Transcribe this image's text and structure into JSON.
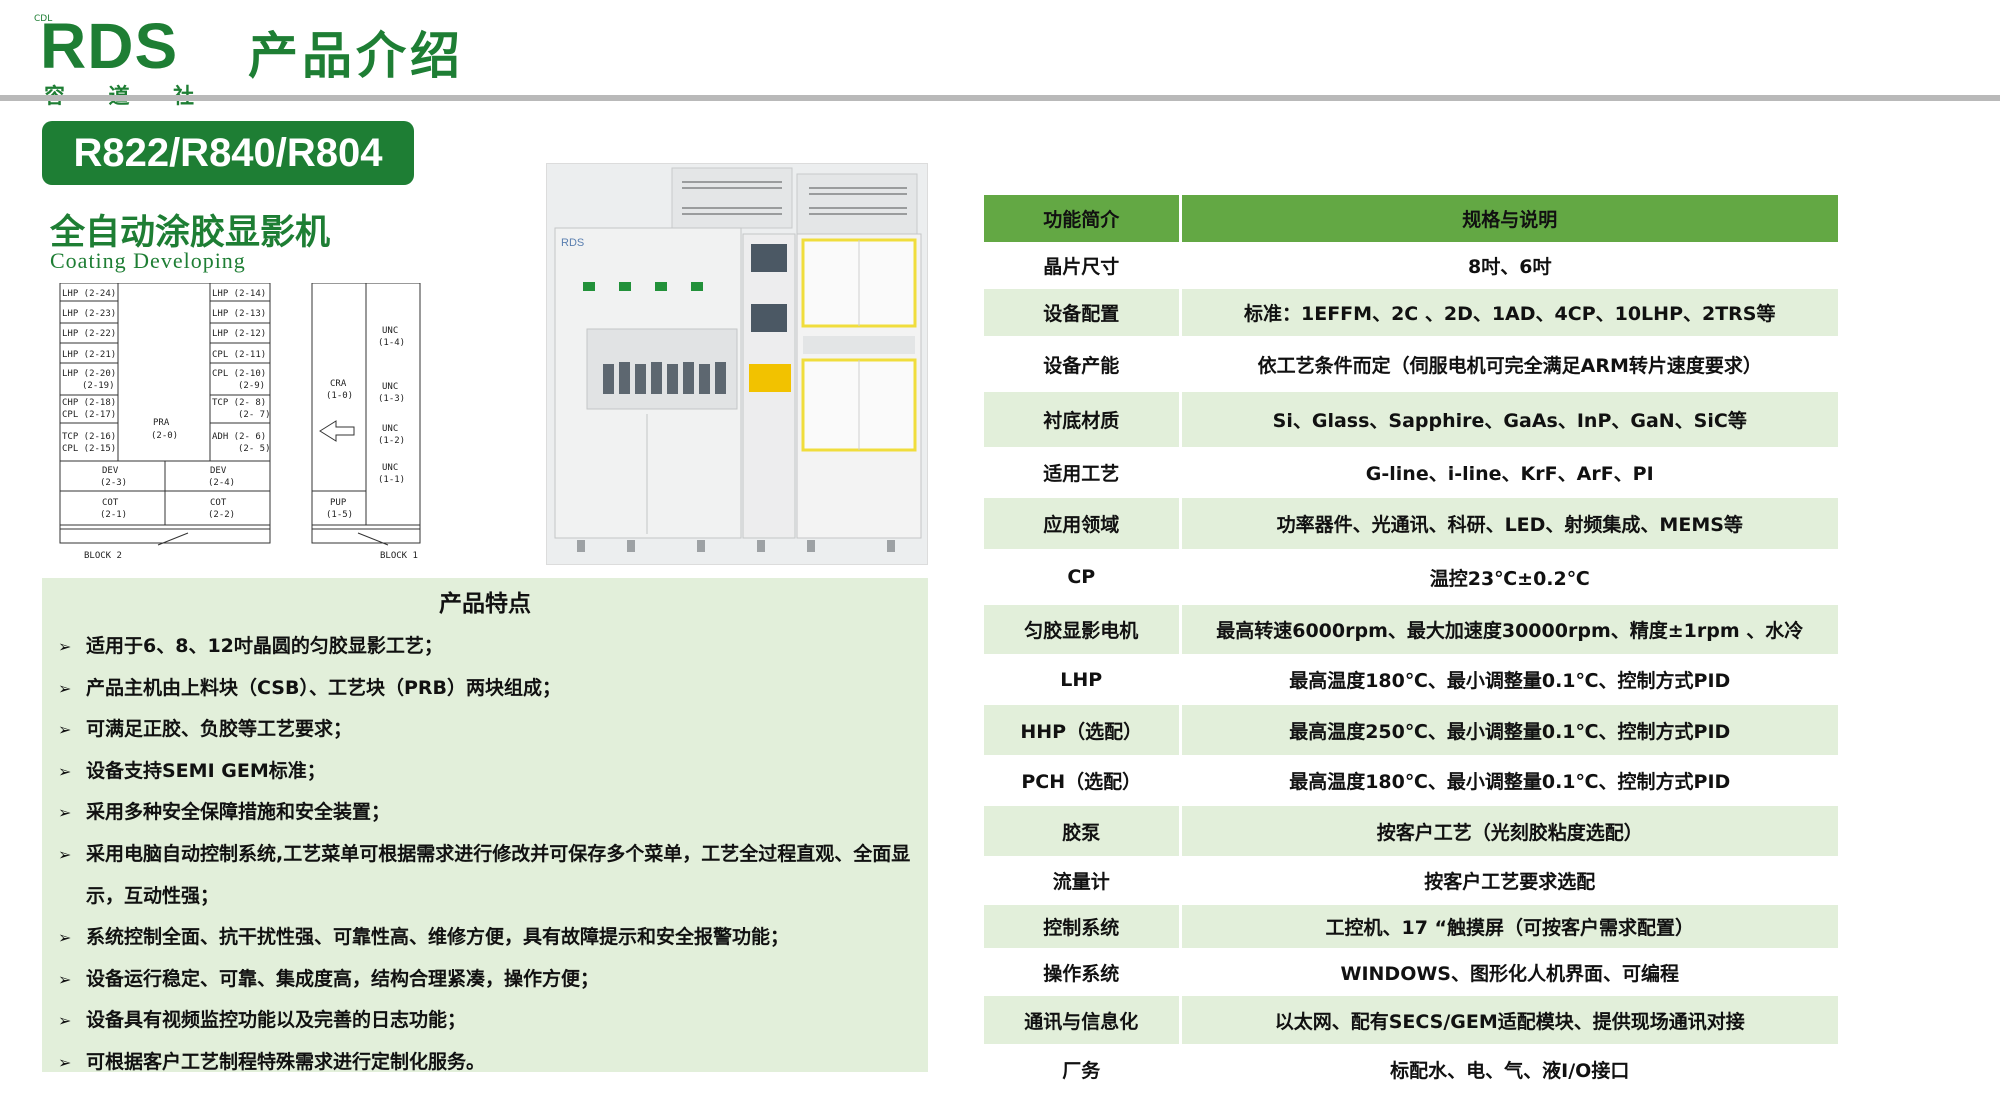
{
  "header": {
    "logo": {
      "tm": "CDL",
      "mark": "RDS",
      "sub": [
        "容",
        "道",
        "社"
      ]
    },
    "title": "产品介绍"
  },
  "product": {
    "model": "R822/R840/R804",
    "name_cn": "全自动涂胶显影机",
    "name_en": "Coating  Developing"
  },
  "layout_diagram": {
    "block2": {
      "left_col": [
        "LHP (2-24)",
        "LHP (2-23)",
        "LHP (2-22)",
        "LHP (2-21)",
        "LHP (2-20)",
        "(2-19)",
        "CHP (2-18)",
        "CPL (2-17)",
        "TCP (2-16)",
        "CPL (2-15)"
      ],
      "right_col": [
        "LHP (2-14)",
        "LHP (2-13)",
        "LHP (2-12)",
        "CPL (2-11)",
        "CPL (2-10)",
        "(2-9)",
        "TCP (2- 8)",
        "(2- 7)",
        "ADH (2- 6)",
        "(2- 5)"
      ],
      "center": [
        "PRA",
        "(2-0)"
      ],
      "dev": [
        [
          "DEV",
          "(2-3)"
        ],
        [
          "DEV",
          "(2-4)"
        ]
      ],
      "cot": [
        [
          "COT",
          "(2-1)"
        ],
        [
          "COT",
          "(2-2)"
        ]
      ],
      "label": "BLOCK 2"
    },
    "block1": {
      "cra": [
        "CRA",
        "(1-0)"
      ],
      "unc": [
        [
          "UNC",
          "(1-4)"
        ],
        [
          "UNC",
          "(1-3)"
        ],
        [
          "UNC",
          "(1-2)"
        ],
        [
          "UNC",
          "(1-1)"
        ]
      ],
      "pup": [
        "PUP",
        "(1-5)"
      ],
      "label": "BLOCK 1"
    }
  },
  "photo": {
    "brand": "RDS"
  },
  "features": {
    "title": "产品特点",
    "items": [
      "适用于6、8、12吋晶圆的匀胶显影工艺；",
      "产品主机由上料块（CSB）、工艺块（PRB）两块组成；",
      "可满足正胶、负胶等工艺要求；",
      "设备支持SEMI GEM标准；",
      "采用多种安全保障措施和安全装置；",
      "采用电脑自动控制系统,工艺菜单可根据需求进行修改并可保存多个菜单，工艺全过程直观、全面显示，互动性强；",
      "系统控制全面、抗干扰性强、可靠性高、维修方便，具有故障提示和安全报警功能；",
      "设备运行稳定、可靠、集成度高，结构合理紧凑，操作方便；",
      "设备具有视频监控功能以及完善的日志功能；",
      "可根据客户工艺制程特殊需求进行定制化服务。"
    ]
  },
  "spec_table": {
    "headers": [
      "功能简介",
      "规格与说明"
    ],
    "rows": [
      [
        "晶片尺寸",
        "8吋、6吋"
      ],
      [
        "设备配置",
        "标准：1EFFM、2C 、2D、1AD、4CP、10LHP、2TRS等"
      ],
      [
        "设备产能",
        "依工艺条件而定（伺服电机可完全满足ARM转片速度要求）"
      ],
      [
        "衬底材质",
        "Si、Glass、Sapphire、GaAs、InP、GaN、SiC等"
      ],
      [
        "适用工艺",
        "G-line、i-line、KrF、ArF、PI"
      ],
      [
        "应用领域",
        "功率器件、光通讯、科研、LED、射频集成、MEMS等"
      ],
      [
        "CP",
        "温控23℃±0.2℃"
      ],
      [
        "匀胶显影电机",
        "最高转速6000rpm、最大加速度30000rpm、精度±1rpm 、水冷"
      ],
      [
        "LHP",
        "最高温度180℃、最小调整量0.1℃、控制方式PID"
      ],
      [
        "HHP（选配）",
        "最高温度250℃、最小调整量0.1℃、控制方式PID"
      ],
      [
        "PCH（选配）",
        "最高温度180℃、最小调整量0.1℃、控制方式PID"
      ],
      [
        "胶泵",
        "按客户工艺（光刻胶粘度选配）"
      ],
      [
        "流量计",
        "按客户工艺要求选配"
      ],
      [
        "控制系统",
        "工控机、17 “触摸屏（可按客户需求配置）"
      ],
      [
        "操作系统",
        "WINDOWS、图形化人机界面、可编程"
      ],
      [
        "通讯与信息化",
        "以太网、配有SECS/GEM适配模块、提供现场通讯对接"
      ],
      [
        "厂务",
        "标配水、电、气、液I/O接口"
      ]
    ],
    "row_heights": [
      47,
      47,
      56,
      55,
      51,
      51,
      56,
      49,
      51,
      50,
      51,
      50,
      49,
      43,
      48,
      48,
      50
    ]
  },
  "colors": {
    "brand_green": "#1e7e34",
    "header_green": "#63a844",
    "light_green": "#e2efda",
    "rule_gray": "#b9b9b9"
  }
}
